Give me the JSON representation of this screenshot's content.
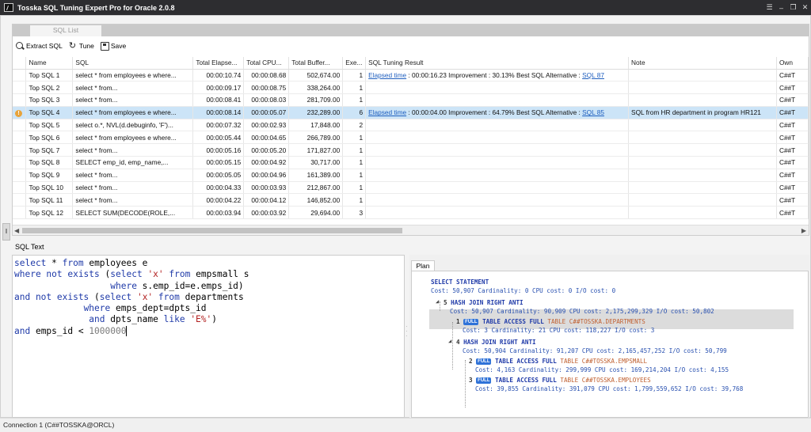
{
  "window": {
    "title": "Tosska SQL Tuning Expert Pro for Oracle 2.0.8",
    "controls": [
      "☰",
      "–",
      "❐",
      "✕"
    ]
  },
  "upper_tab": "SQL List",
  "toolbar": {
    "extract_label": "Extract SQL",
    "tune_label": "Tune",
    "save_label": "Save"
  },
  "grid": {
    "columns": [
      "Name",
      "SQL",
      "Total Elapse...",
      "Total CPU...",
      "Total Buffer...",
      "Exe...",
      "SQL Tuning Result",
      "Note",
      "Own"
    ],
    "rows": [
      {
        "name": "Top SQL 1",
        "sql": "select * from employees e where...",
        "elapsed": "00:00:10.74",
        "cpu": "00:00:08.68",
        "buffer": "502,674.00",
        "exe": "1",
        "result_link": "Elapsed time",
        "result_text": " : 00:00:16.23   Improvement : 30.13%   Best SQL Alternative : ",
        "result_sql": "SQL 87",
        "note": "",
        "owner": "C##T"
      },
      {
        "name": "Top SQL 2",
        "sql": "select * from...",
        "elapsed": "00:00:09.17",
        "cpu": "00:00:08.75",
        "buffer": "338,264.00",
        "exe": "1",
        "result_link": "",
        "result_text": "",
        "result_sql": "",
        "note": "",
        "owner": "C##T"
      },
      {
        "name": "Top SQL 3",
        "sql": "select * from...",
        "elapsed": "00:00:08.41",
        "cpu": "00:00:08.03",
        "buffer": "281,709.00",
        "exe": "1",
        "result_link": "",
        "result_text": "",
        "result_sql": "",
        "note": "",
        "owner": "C##T"
      },
      {
        "name": "Top SQL 4",
        "sql": "select * from employees e where...",
        "elapsed": "00:00:08.14",
        "cpu": "00:00:05.07",
        "buffer": "232,289.00",
        "exe": "6",
        "result_link": "Elapsed time",
        "result_text": " : 00:00:04.00   Improvement : 64.79%   Best SQL Alternative : ",
        "result_sql": "SQL 85",
        "note": "SQL from HR department in program HR121",
        "owner": "C##T"
      },
      {
        "name": "Top SQL 5",
        "sql": "select o.*, NVL(d.debuginfo, 'F')...",
        "elapsed": "00:00:07.32",
        "cpu": "00:00:02.93",
        "buffer": "17,848.00",
        "exe": "2",
        "result_link": "",
        "result_text": "",
        "result_sql": "",
        "note": "",
        "owner": "C##T"
      },
      {
        "name": "Top SQL 6",
        "sql": "select * from employees e where...",
        "elapsed": "00:00:05.44",
        "cpu": "00:00:04.65",
        "buffer": "266,789.00",
        "exe": "1",
        "result_link": "",
        "result_text": "",
        "result_sql": "",
        "note": "",
        "owner": "C##T"
      },
      {
        "name": "Top SQL 7",
        "sql": "select * from...",
        "elapsed": "00:00:05.16",
        "cpu": "00:00:05.20",
        "buffer": "171,827.00",
        "exe": "1",
        "result_link": "",
        "result_text": "",
        "result_sql": "",
        "note": "",
        "owner": "C##T"
      },
      {
        "name": "Top SQL 8",
        "sql": "SELECT emp_id,         emp_name,...",
        "elapsed": "00:00:05.15",
        "cpu": "00:00:04.92",
        "buffer": "30,717.00",
        "exe": "1",
        "result_link": "",
        "result_text": "",
        "result_sql": "",
        "note": "",
        "owner": "C##T"
      },
      {
        "name": "Top SQL 9",
        "sql": "select * from...",
        "elapsed": "00:00:05.05",
        "cpu": "00:00:04.96",
        "buffer": "161,389.00",
        "exe": "1",
        "result_link": "",
        "result_text": "",
        "result_sql": "",
        "note": "",
        "owner": "C##T"
      },
      {
        "name": "Top SQL 10",
        "sql": "select * from...",
        "elapsed": "00:00:04.33",
        "cpu": "00:00:03.93",
        "buffer": "212,867.00",
        "exe": "1",
        "result_link": "",
        "result_text": "",
        "result_sql": "",
        "note": "",
        "owner": "C##T"
      },
      {
        "name": "Top SQL 11",
        "sql": "select * from...",
        "elapsed": "00:00:04.22",
        "cpu": "00:00:04.12",
        "buffer": "146,852.00",
        "exe": "1",
        "result_link": "",
        "result_text": "",
        "result_sql": "",
        "note": "",
        "owner": "C##T"
      },
      {
        "name": "Top SQL 12",
        "sql": "SELECT SUM(DECODE(ROLE,...",
        "elapsed": "00:00:03.94",
        "cpu": "00:00:03.92",
        "buffer": "29,694.00",
        "exe": "3",
        "result_link": "",
        "result_text": "",
        "result_sql": "",
        "note": "",
        "owner": "C##T"
      }
    ],
    "selected_row": 3,
    "warning_glyph": "!"
  },
  "sql_text": {
    "label": "SQL Text",
    "lines": [
      [
        [
          "kw",
          "select"
        ],
        [
          "t",
          " * "
        ],
        [
          "kw",
          "from"
        ],
        [
          "t",
          " employees e"
        ]
      ],
      [
        [
          "kw",
          "where not exists"
        ],
        [
          "t",
          " ("
        ],
        [
          "kw",
          "select"
        ],
        [
          "t",
          " "
        ],
        [
          "str",
          "'x'"
        ],
        [
          "t",
          " "
        ],
        [
          "kw",
          "from"
        ],
        [
          "t",
          " empsmall s"
        ]
      ],
      [
        [
          "t",
          "                  "
        ],
        [
          "kw",
          "where"
        ],
        [
          "t",
          " s.emp_id=e.emps_id)"
        ]
      ],
      [
        [
          "kw",
          "and not exists"
        ],
        [
          "t",
          " ("
        ],
        [
          "kw",
          "select"
        ],
        [
          "t",
          " "
        ],
        [
          "str",
          "'x'"
        ],
        [
          "t",
          " "
        ],
        [
          "kw",
          "from"
        ],
        [
          "t",
          " departments"
        ]
      ],
      [
        [
          "t",
          "             "
        ],
        [
          "kw",
          "where"
        ],
        [
          "t",
          " emps_dept=dpts_id"
        ]
      ],
      [
        [
          "t",
          "              "
        ],
        [
          "kw",
          "and"
        ],
        [
          "t",
          " dpts_name "
        ],
        [
          "kw",
          "like"
        ],
        [
          "t",
          " "
        ],
        [
          "str",
          "'E%'"
        ],
        [
          "t",
          ")"
        ]
      ],
      [
        [
          "kw",
          "and"
        ],
        [
          "t",
          " emps_id < "
        ],
        [
          "cmp",
          "1000000"
        ]
      ]
    ]
  },
  "plan": {
    "tab_label": "Plan",
    "nodes": [
      {
        "id": "",
        "badge": "",
        "op": "SELECT STATEMENT",
        "table": "",
        "stats": "Cost: 50,907  Cardinality: 0  CPU cost: 0  I/O cost: 0"
      },
      {
        "id": "5",
        "badge": "",
        "op": "HASH JOIN RIGHT ANTI",
        "table": "",
        "stats": "Cost: 50,907  Cardinality: 90,909  CPU cost: 2,175,299,329  I/O cost: 50,802"
      },
      {
        "id": "1",
        "badge": "FULL",
        "op": "TABLE ACCESS FULL",
        "table": "TABLE C##TOSSKA.DEPARTMENTS",
        "stats": "Cost: 3  Cardinality: 21  CPU cost: 118,227  I/O cost: 3"
      },
      {
        "id": "4",
        "badge": "",
        "op": "HASH JOIN RIGHT ANTI",
        "table": "",
        "stats": "Cost: 50,904  Cardinality: 91,207  CPU cost: 2,165,457,252  I/O cost: 50,799"
      },
      {
        "id": "2",
        "badge": "FULL",
        "op": "TABLE ACCESS FULL",
        "table": "TABLE C##TOSSKA.EMPSMALL",
        "stats": "Cost: 4,163  Cardinality: 299,999  CPU cost: 169,214,204  I/O cost: 4,155"
      },
      {
        "id": "3",
        "badge": "FULL",
        "op": "TABLE ACCESS FULL",
        "table": "TABLE C##TOSSKA.EMPLOYEES",
        "stats": "Cost: 39,855  Cardinality: 391,079  CPU cost: 1,799,559,652  I/O cost: 39,768"
      }
    ]
  },
  "status": {
    "connection": "Connection 1 (C##TOSSKA@ORCL)"
  }
}
